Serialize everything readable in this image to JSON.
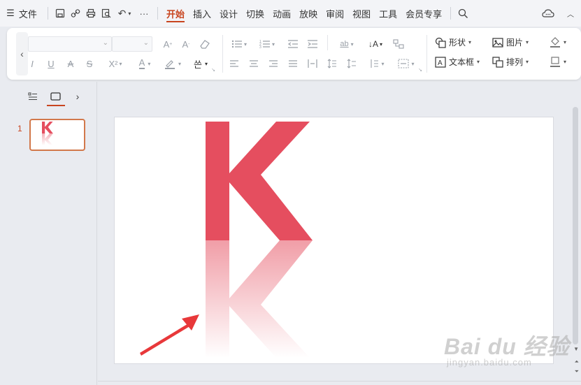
{
  "menu": {
    "file_label": "文件",
    "tabs": [
      {
        "label": "开始",
        "active": true
      },
      {
        "label": "插入"
      },
      {
        "label": "设计"
      },
      {
        "label": "切换"
      },
      {
        "label": "动画"
      },
      {
        "label": "放映"
      },
      {
        "label": "审阅"
      },
      {
        "label": "视图"
      },
      {
        "label": "工具"
      },
      {
        "label": "会员专享"
      }
    ]
  },
  "ribbon": {
    "shape_label": "形状",
    "picture_label": "图片",
    "textbox_label": "文本框",
    "arrange_label": "排列"
  },
  "slides_panel": {
    "slide_number": "1",
    "thumb_letter": "K"
  },
  "slide": {
    "letter": "K"
  },
  "watermark": {
    "big": "Bai du 经验",
    "small": "jingyan.baidu.com"
  },
  "colors": {
    "accent": "#c8451f",
    "letter": "#e54e5f",
    "arrow": "#e8383a"
  }
}
